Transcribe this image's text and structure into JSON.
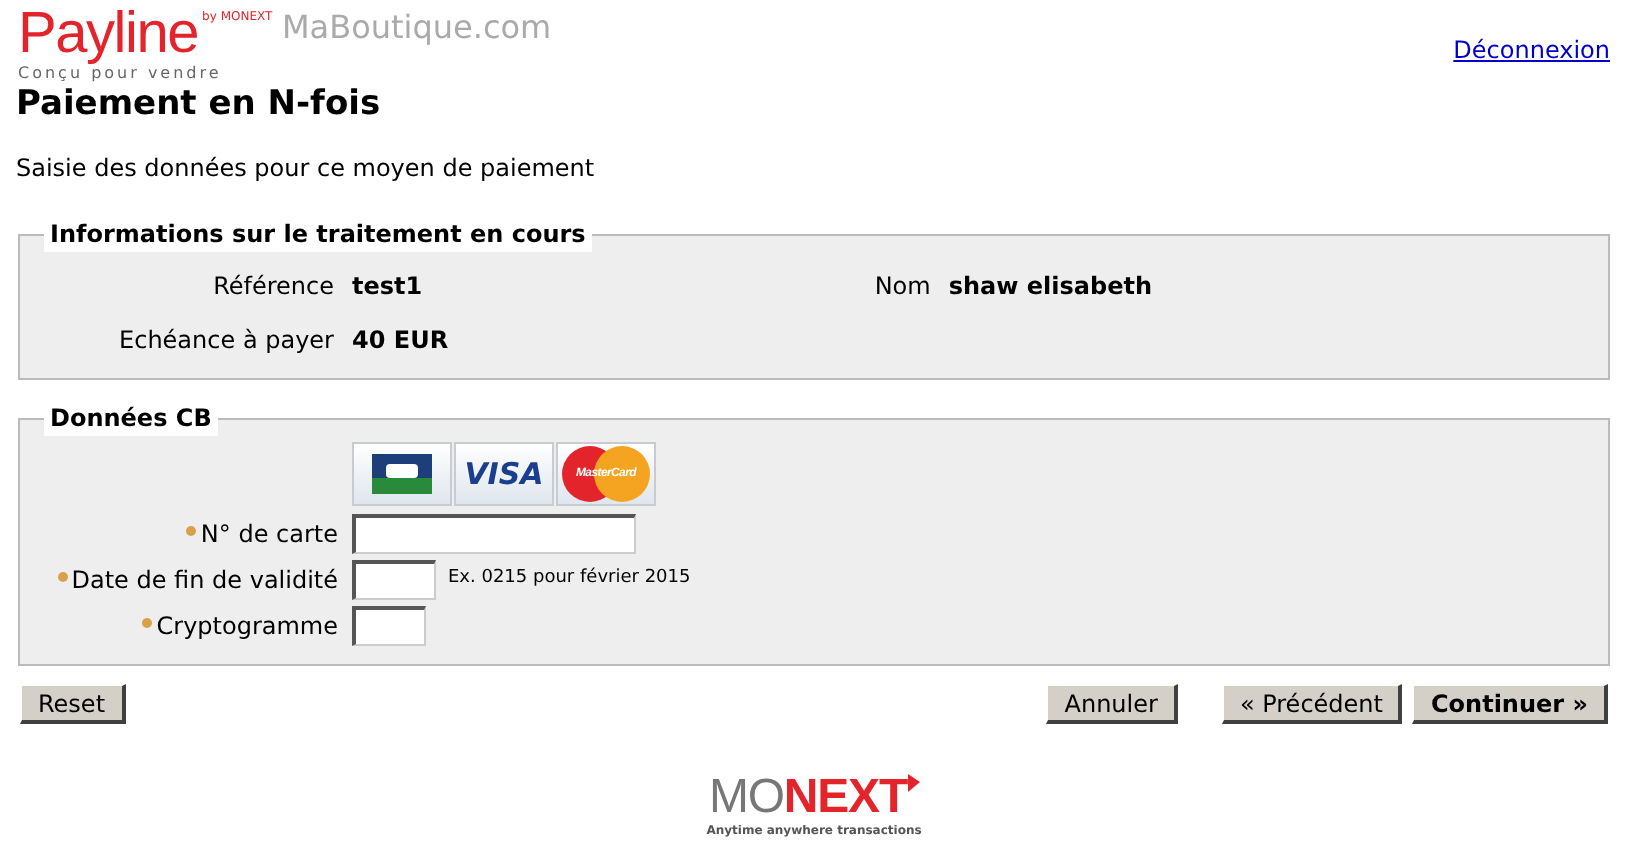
{
  "header": {
    "brand": "Payline",
    "brand_by": "by MONEXT",
    "tagline": "Conçu pour vendre",
    "shop": "MaBoutique.com",
    "logout": "Déconnexion"
  },
  "title": "Paiement en N-fois",
  "subtitle": "Saisie des données pour ce moyen de paiement",
  "info": {
    "legend": "Informations sur le traitement en cours",
    "rows": [
      {
        "label": "Référence",
        "value": "test1"
      },
      {
        "label": "Echéance à payer",
        "value": "40 EUR"
      }
    ],
    "side": {
      "label": "Nom",
      "value": "shaw elisabeth"
    }
  },
  "card": {
    "legend": "Données CB",
    "brands": [
      {
        "kind": "cb"
      },
      {
        "kind": "visa",
        "text": "VISA"
      },
      {
        "kind": "mastercard",
        "text": "MasterCard"
      }
    ],
    "fields": [
      {
        "label": "N° de carte",
        "kind": "long"
      },
      {
        "label": "Date de fin de validité",
        "kind": "medium",
        "hint": "Ex. 0215 pour février 2015"
      },
      {
        "label": "Cryptogramme",
        "kind": "short"
      }
    ]
  },
  "buttons": {
    "left": "Reset",
    "right": [
      {
        "label": "Annuler",
        "primary": false
      },
      {
        "label": "« Précédent",
        "primary": false
      },
      {
        "label": "Continuer »",
        "primary": true
      }
    ]
  },
  "footer": {
    "logo_a": "MO",
    "logo_b": "NEXT",
    "slogan": "Anytime anywhere transactions"
  }
}
